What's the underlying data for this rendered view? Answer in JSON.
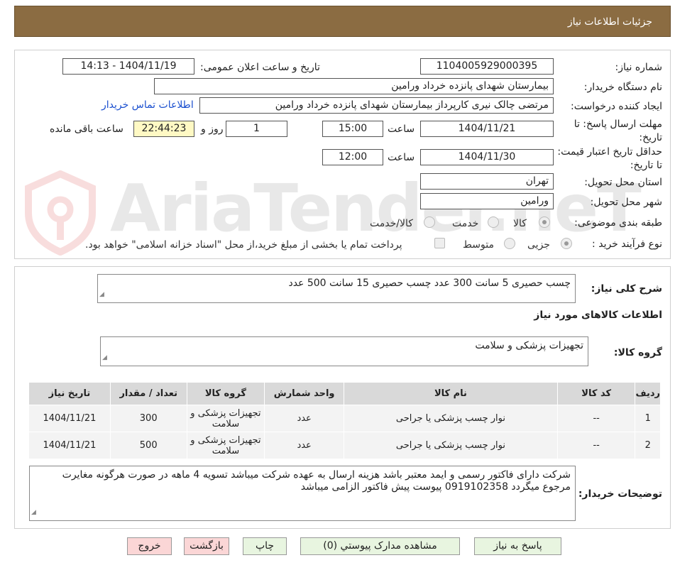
{
  "header": {
    "title": "جزئیات اطلاعات نیاز"
  },
  "labels": {
    "need_number": "شماره نیاز:",
    "announce_datetime": "تاریخ و ساعت اعلان عمومی:",
    "buyer_org": "نام دستگاه خریدار:",
    "requester": "ایجاد کننده درخواست:",
    "reply_deadline": "مهلت ارسال پاسخ: تا تاریخ:",
    "time_word": "ساعت",
    "day_word": "روز و",
    "remaining": "ساعت باقی مانده",
    "validity": "حداقل تاریخ اعتبار قیمت: تا تاریخ:",
    "province": "استان محل تحویل:",
    "city": "شهر محل تحویل:",
    "category": "طبقه بندی موضوعی:",
    "process": "نوع فرآیند خرید :",
    "summary": "شرح کلی نیاز:",
    "goods_info": "اطلاعات کالاهای مورد نیاز",
    "goods_group": "گروه کالا:",
    "buyer_notes": "توضیحات خریدار:"
  },
  "values": {
    "need_number": "1104005929000395",
    "announce_datetime": "1404/11/19 - 14:13",
    "buyer_org": "بیمارستان شهدای پانزده خرداد ورامین",
    "requester": "مرتضی چالک نیری کارپرداز بیمارستان شهدای پانزده خرداد ورامین",
    "contact_link": "اطلاعات تماس خریدار",
    "reply_date": "1404/11/21",
    "reply_time": "15:00",
    "reply_days": "1",
    "reply_remaining": "22:44:23",
    "validity_date": "1404/11/30",
    "validity_time": "12:00",
    "province": "تهران",
    "city": "ورامین",
    "summary": "چسب حصیری 5 سانت 300 عدد چسب حصیری 15 سانت 500 عدد",
    "goods_group": "تجهیزات پزشکی و سلامت",
    "buyer_notes": "شرکت دارای فاکتور رسمی و ایمد معتبر باشد هزینه ارسال به عهده شرکت میباشد تسویه 4 ماهه در صورت هرگونه مغایرت مرجوع میگردد 0919102358 پیوست پیش فاکتور الزامی میباشد"
  },
  "category_options": [
    "کالا",
    "خدمت",
    "کالا/خدمت"
  ],
  "category_selected": "کالا",
  "process_options": [
    "جزیی",
    "متوسط"
  ],
  "process_selected": "جزیی",
  "treasury_note": "پرداخت تمام یا بخشی از مبلغ خرید،از محل \"اسناد خزانه اسلامی\" خواهد بود.",
  "table": {
    "headers": [
      "ردیف",
      "کد کالا",
      "نام کالا",
      "واحد شمارش",
      "گروه کالا",
      "تعداد / مقدار",
      "تاریخ نیاز"
    ],
    "rows": [
      [
        "1",
        "--",
        "نوار چسب پزشکی یا جراحی",
        "عدد",
        "تجهیزات پزشکی و سلامت",
        "300",
        "1404/11/21"
      ],
      [
        "2",
        "--",
        "نوار چسب پزشکی یا جراحی",
        "عدد",
        "تجهیزات پزشکی و سلامت",
        "500",
        "1404/11/21"
      ]
    ]
  },
  "buttons": {
    "reply": "پاسخ به نیاز",
    "attachments": "مشاهده مدارک پیوستي (0)",
    "print": "چاپ",
    "back": "بازگشت",
    "exit": "خروج"
  },
  "watermark": "AriaTender.neT",
  "colors": {
    "header": "#8b6c42",
    "link": "#1a4fcf",
    "yellow_box": "#fff9c4",
    "button_green": "#e8f5e0",
    "button_red": "#fbd6d6"
  }
}
